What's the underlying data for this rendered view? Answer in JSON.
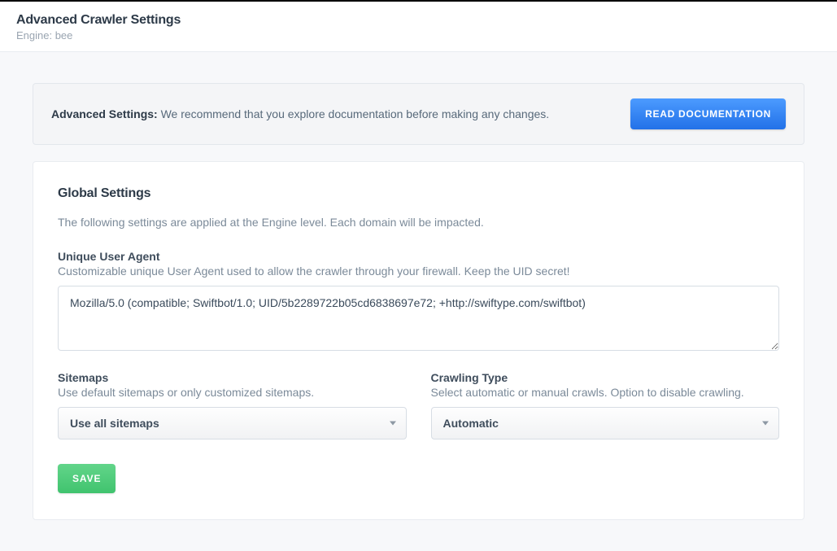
{
  "header": {
    "title": "Advanced Crawler Settings",
    "engine_label": "Engine: bee"
  },
  "banner": {
    "strong": "Advanced Settings:",
    "text": " We recommend that you explore documentation before making any changes.",
    "button": "READ DOCUMENTATION"
  },
  "card": {
    "title": "Global Settings",
    "description": "The following settings are applied at the Engine level. Each domain will be impacted.",
    "user_agent": {
      "label": "Unique User Agent",
      "help": "Customizable unique User Agent used to allow the crawler through your firewall. Keep the UID secret!",
      "value": "Mozilla/5.0 (compatible; Swiftbot/1.0; UID/5b2289722b05cd6838697e72; +http://swiftype.com/swiftbot)"
    },
    "sitemaps": {
      "label": "Sitemaps",
      "help": "Use default sitemaps or only customized sitemaps.",
      "selected": "Use all sitemaps"
    },
    "crawling_type": {
      "label": "Crawling Type",
      "help": "Select automatic or manual crawls. Option to disable crawling.",
      "selected": "Automatic"
    },
    "save_button": "SAVE"
  }
}
